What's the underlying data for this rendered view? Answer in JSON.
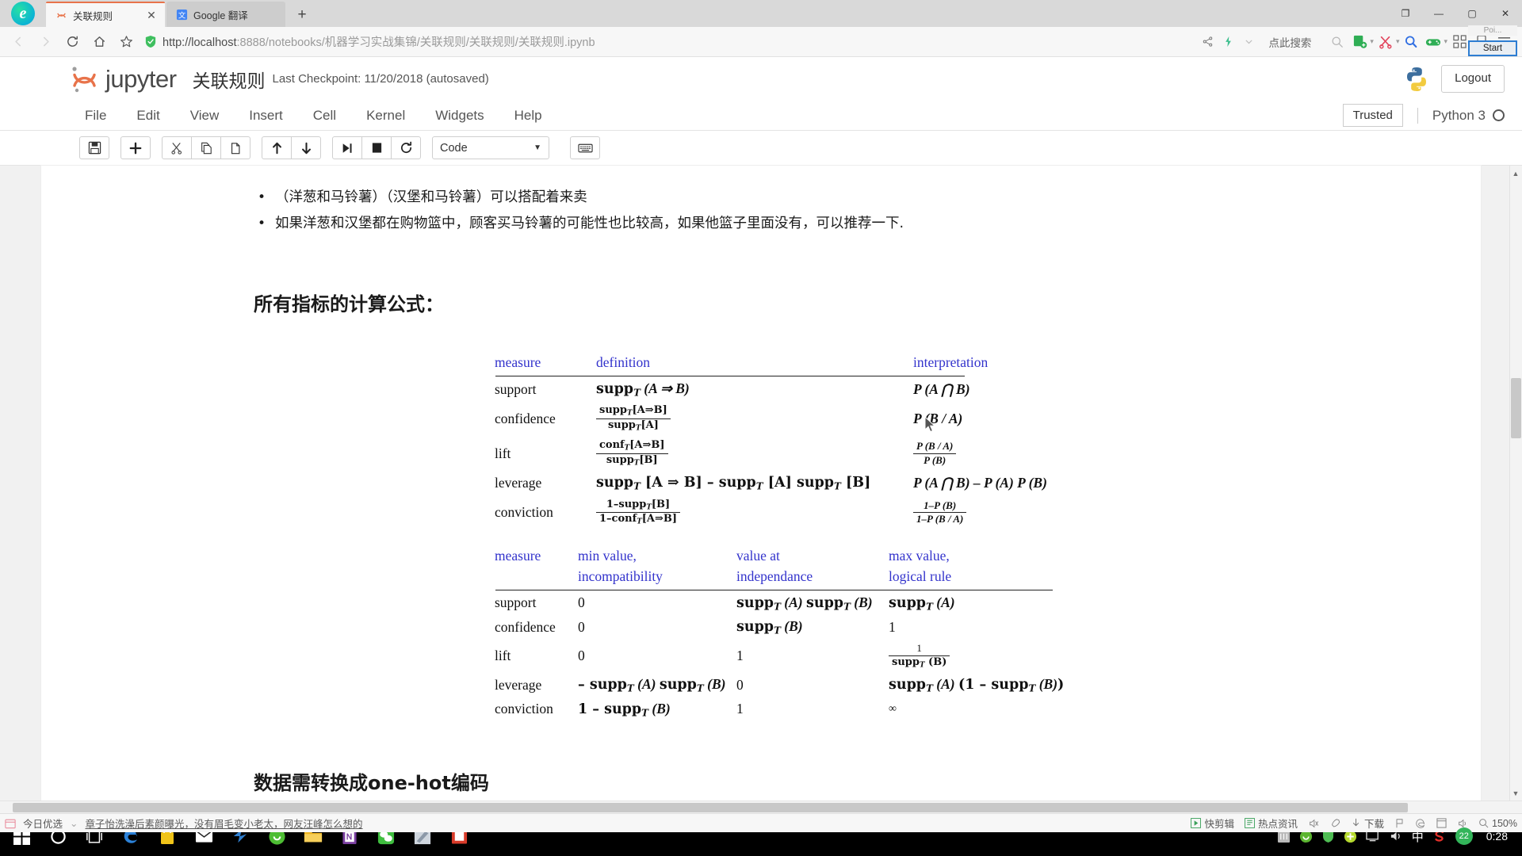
{
  "browser": {
    "tabs": [
      {
        "title": "关联规则",
        "favicon": "jupyter-icon",
        "active": true,
        "close": "✕"
      },
      {
        "title": "Google 翻译",
        "favicon": "translate-icon",
        "active": false
      }
    ],
    "newtab_label": "+",
    "window_controls": {
      "minimize": "—",
      "maximize": "▢",
      "close": "✕",
      "restore": "❐"
    },
    "nav": {
      "back": "←",
      "forward": "→",
      "reload": "⟳",
      "home": "⌂",
      "favorite": "☆"
    },
    "url": {
      "scheme_host": "http://localhost",
      "rest": ":8888/notebooks/机器学习实战集锦/关联规则/关联规则/关联规则.ipynb",
      "full": "http://localhost:8888/notebooks/机器学习实战集锦/关联规则/关联规则/关联规则.ipynb"
    },
    "search_label": "点此搜索",
    "hint_tooltip": {
      "label": "Poi...",
      "button": "Start"
    }
  },
  "jupyter": {
    "logo_text": "jupyter",
    "notebook_name": "关联规则",
    "checkpoint": "Last Checkpoint: 11/20/2018 (autosaved)",
    "logout_label": "Logout",
    "menu": [
      "File",
      "Edit",
      "View",
      "Insert",
      "Cell",
      "Kernel",
      "Widgets",
      "Help"
    ],
    "trusted_label": "Trusted",
    "kernel_label": "Python 3",
    "toolbar": {
      "save": "save-icon",
      "insert": "plus-icon",
      "cut": "scissors-icon",
      "copy": "copy-icon",
      "paste": "paste-icon",
      "move_up": "arrow-up-icon",
      "move_down": "arrow-down-icon",
      "run": "run-icon",
      "stop": "stop-icon",
      "restart": "restart-icon",
      "cell_type": "Code",
      "cell_type_caret": "▼",
      "keyboard": "keyboard-icon"
    }
  },
  "notebook": {
    "bullets": [
      "（洋葱和马铃薯）（汉堡和马铃薯）可以搭配着来卖",
      "如果洋葱和汉堡都在购物篮中，顾客买马铃薯的可能性也比较高，如果他篮子里面没有，可以推荐一下."
    ],
    "heading_formula": "所有指标的计算公式：",
    "heading_onehot": "数据需转换成one-hot编码",
    "table1": {
      "headers": [
        "measure",
        "definition",
        "interpretation"
      ],
      "rows": [
        {
          "measure": "support",
          "definition_html": "supp_T (A ⇒ B)",
          "interpretation_html": "P (A ∩ B)"
        },
        {
          "measure": "confidence",
          "definition_html": "supp_T[A⇒B] / supp_T[A]",
          "interpretation_html": "P (B / A)"
        },
        {
          "measure": "lift",
          "definition_html": "conf_T[A⇒B] / supp_T[B]",
          "interpretation_html": "P(B / A) / P(B)"
        },
        {
          "measure": "leverage",
          "definition_html": "supp_T [A ⇒ B] − supp_T [A] supp_T [B]",
          "interpretation_html": "P (A ∩ B) − P (A) P (B)"
        },
        {
          "measure": "conviction",
          "definition_html": "1−supp_T[B] / 1−conf_T[A⇒B]",
          "interpretation_html": "1−P(B) / 1−P(B / A)"
        }
      ]
    },
    "table2": {
      "headers": [
        {
          "l1": "measure",
          "l2": ""
        },
        {
          "l1": "min value,",
          "l2": "incompatibility"
        },
        {
          "l1": "value at",
          "l2": "independance"
        },
        {
          "l1": "max value,",
          "l2": "logical rule"
        }
      ],
      "rows": [
        {
          "measure": "support",
          "min": "0",
          "indep": "supp_T (A) supp_T (B)",
          "max": "supp_T (A)"
        },
        {
          "measure": "confidence",
          "min": "0",
          "indep": "supp_T (B)",
          "max": "1"
        },
        {
          "measure": "lift",
          "min": "0",
          "indep": "1",
          "max": "1 / supp_T (B)"
        },
        {
          "measure": "leverage",
          "min": "− supp_T (A) supp_T (B)",
          "indep": "0",
          "max": "supp_T (A) (1 − supp_T (B))"
        },
        {
          "measure": "conviction",
          "min": "1 − supp_T (B)",
          "indep": "1",
          "max": "∞"
        }
      ]
    }
  },
  "statusbar": {
    "today_label": "今日优选",
    "news": "章子怡洗澡后素颜曝光，没有眉毛变小老太，网友汪峰怎么想的",
    "items": [
      {
        "icon": "clip-icon",
        "label": "快剪辑"
      },
      {
        "icon": "hotnews-icon",
        "label": "热点资讯"
      },
      {
        "icon": "mute-icon",
        "label": ""
      },
      {
        "icon": "rocket-icon",
        "label": ""
      },
      {
        "icon": "download-icon",
        "label": "下载"
      },
      {
        "icon": "flag-icon",
        "label": ""
      },
      {
        "icon": "edge-icon",
        "label": ""
      },
      {
        "icon": "window-icon",
        "label": ""
      },
      {
        "icon": "volume-icon",
        "label": ""
      },
      {
        "icon": "zoom-search-icon",
        "label": ""
      }
    ],
    "zoom": "150%"
  },
  "taskbar": {
    "items": [
      "start-icon",
      "cortana-icon",
      "taskview-icon",
      "edge-icon",
      "store-icon",
      "mail-icon",
      "flyicon",
      "360-browser-icon",
      "folder-icon",
      "onenote-icon",
      "wechat-icon",
      "tool-icon",
      "office-icon"
    ],
    "tray": [
      "ime-panel-icon",
      "browser-icon",
      "shield-icon",
      "plus-icon",
      "monitor-icon",
      "volume-icon"
    ],
    "ime_label": "中",
    "sogou_label": "S",
    "badge": "22",
    "clock": "0:28"
  },
  "colors": {
    "jupyter_orange": "#e8734a",
    "table_header_blue": "#3333cc",
    "accent_blue": "#2d7dd2"
  }
}
